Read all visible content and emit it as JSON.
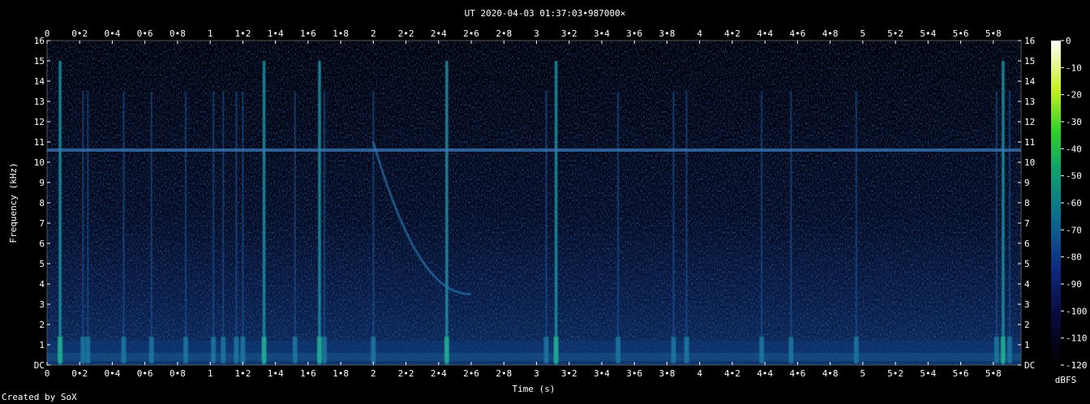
{
  "chart_data": {
    "type": "heatmap",
    "title": "UT 2020-04-03 01:37:03•987000×",
    "xlabel": "Time (s)",
    "ylabel": "Frequency (kHz)",
    "xlim": [
      0,
      5.97
    ],
    "ylim": [
      0,
      16
    ],
    "x_ticks": [
      "0",
      "0•2",
      "0•4",
      "0•6",
      "0•8",
      "1",
      "1•2",
      "1•4",
      "1•6",
      "1•8",
      "2",
      "2•2",
      "2•4",
      "2•6",
      "2•8",
      "3",
      "3•2",
      "3•4",
      "3•6",
      "3•8",
      "4",
      "4•2",
      "4•4",
      "4•6",
      "4•8",
      "5",
      "5•2",
      "5•4",
      "5•6",
      "5•8"
    ],
    "y_ticks": [
      "DC",
      "1",
      "2",
      "3",
      "4",
      "5",
      "6",
      "7",
      "8",
      "9",
      "10",
      "11",
      "12",
      "13",
      "14",
      "15",
      "16"
    ],
    "colorbar": {
      "label": "dBFS",
      "ticks": [
        "0",
        "-10",
        "-20",
        "-30",
        "-40",
        "-50",
        "-60",
        "-70",
        "-80",
        "-90",
        "-100",
        "-110",
        "-120"
      ],
      "range": [
        -120,
        0
      ]
    },
    "features": {
      "carrier_line_khz": 10.6,
      "sferics_s": [
        0.08,
        0.22,
        0.25,
        0.47,
        0.64,
        0.85,
        1.02,
        1.08,
        1.16,
        1.2,
        1.33,
        1.52,
        1.67,
        1.7,
        2.0,
        2.45,
        3.06,
        3.12,
        3.5,
        3.84,
        3.92,
        4.38,
        4.56,
        4.96,
        5.82,
        5.86,
        5.9
      ],
      "strong_sferics_s": [
        0.08,
        1.33,
        1.67,
        2.45,
        3.12,
        5.86
      ],
      "whistler": {
        "start_s": 2.0,
        "end_s": 2.6,
        "start_khz": 11,
        "end_khz": 3.5
      }
    },
    "grid": false
  },
  "footer": {
    "credit": "Created by SoX"
  }
}
